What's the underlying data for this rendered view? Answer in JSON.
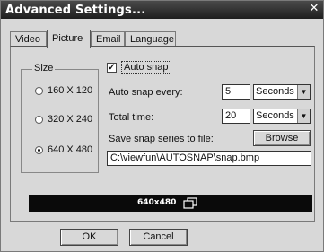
{
  "window": {
    "title": "Advanced Settings...",
    "close_glyph": "✕"
  },
  "tabs": [
    {
      "label": "Video",
      "active": false
    },
    {
      "label": "Picture",
      "active": true
    },
    {
      "label": "Email",
      "active": false
    },
    {
      "label": "Language",
      "active": false
    }
  ],
  "size_group": {
    "legend": "Size",
    "options": [
      {
        "label": "160 X 120",
        "selected": false
      },
      {
        "label": "320 X 240",
        "selected": false
      },
      {
        "label": "640 X 480",
        "selected": true
      }
    ]
  },
  "auto_snap": {
    "checkbox_label": "Auto snap",
    "checked": true,
    "every_label": "Auto snap every:",
    "every_value": "5",
    "every_unit": "Seconds",
    "total_label": "Total time:",
    "total_value": "20",
    "total_unit": "Seconds",
    "save_label": "Save snap series to file:",
    "browse_label": "Browse",
    "file_path": "C:\\viewfun\\AUTOSNAP\\snap.bmp"
  },
  "preview": {
    "resolution": "640x480",
    "icon": "windows-icon"
  },
  "footer": {
    "ok_label": "OK",
    "cancel_label": "Cancel"
  }
}
